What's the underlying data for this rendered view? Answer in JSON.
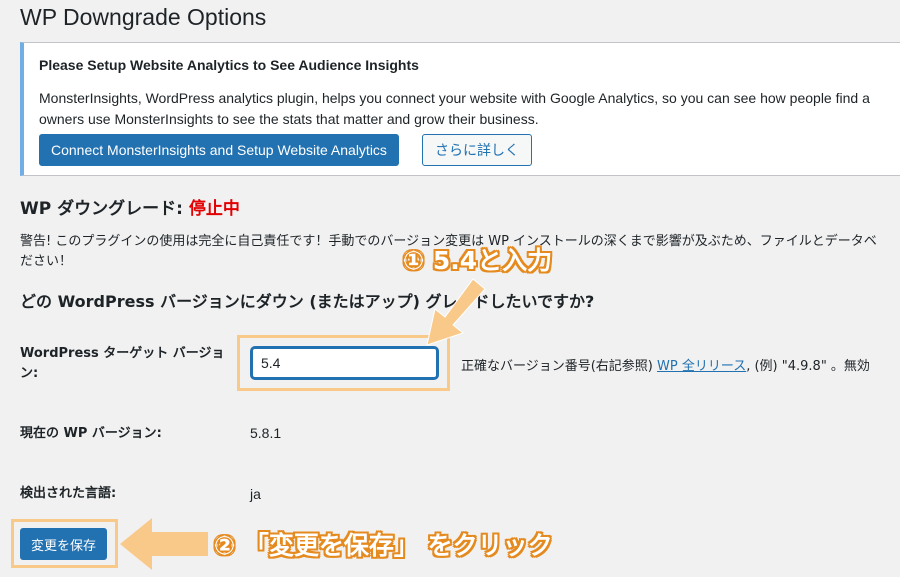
{
  "page": {
    "title": "WP Downgrade Options"
  },
  "notice": {
    "title": "Please Setup Website Analytics to See Audience Insights",
    "line1": "MonsterInsights, WordPress analytics plugin, helps you connect your website with Google Analytics, so you can see how people find a",
    "line2": "owners use MonsterInsights to see the stats that matter and grow their business.",
    "connect_label": "Connect MonsterInsights and Setup Website Analytics",
    "more_label": "さらに詳しく"
  },
  "status": {
    "label": "WP ダウングレード: ",
    "value": "停止中"
  },
  "warning": {
    "line1": "警告! このプラグインの使用は完全に自己責任です！手動でのバージョン変更は WP インストールの深くまで影響が及ぶため、ファイルとデータベ",
    "line2": "ださい！"
  },
  "question": "どの WordPress バージョンにダウン (またはアップ) グレードしたいですか?",
  "fields": {
    "target_label": "WordPress ターゲット バージョン:",
    "target_value": "5.4",
    "target_desc_prefix": "正確なバージョン番号(右記参照) ",
    "target_desc_link": "WP 全リリース",
    "target_desc_suffix": ", (例) \"4.9.8\" 。無効",
    "current_label": "現在の WP バージョン:",
    "current_value": "5.8.1",
    "lang_label": "検出された言語:",
    "lang_value": "ja"
  },
  "save_label": "変更を保存",
  "annotations": {
    "step1": "① 5.4と入力",
    "step2": "② 「変更を保存」 をクリック",
    "color": "#f9c98a"
  }
}
